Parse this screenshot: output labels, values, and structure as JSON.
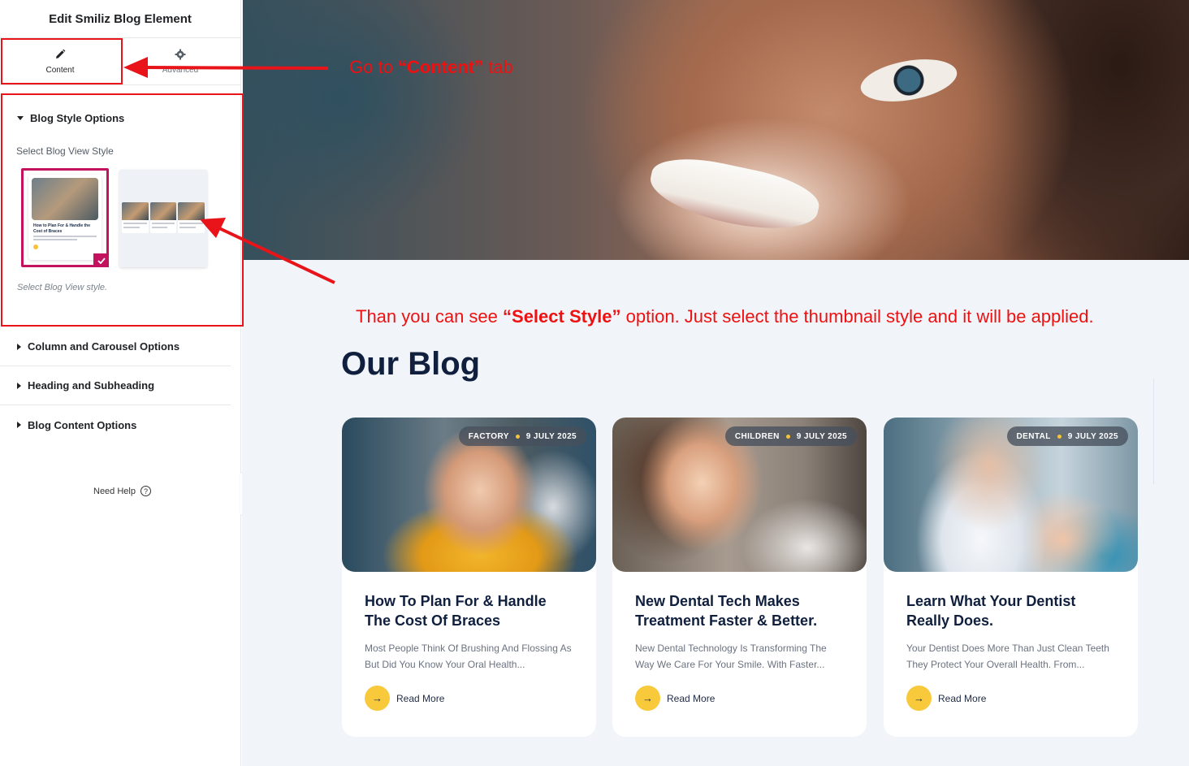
{
  "sidebar": {
    "title": "Edit Smiliz Blog Element",
    "tabs": [
      {
        "label": "Content",
        "icon": "pencil-icon",
        "active": true
      },
      {
        "label": "Advanced",
        "icon": "gear-icon",
        "active": false
      }
    ],
    "blog_style": {
      "header": "Blog Style Options",
      "field_label": "Select Blog View Style",
      "hint": "Select Blog View style.",
      "thumb1": {
        "title": "How to Plan For & Handle the Cost of Braces"
      },
      "selected": 1
    },
    "sections": [
      "Column and Carousel Options",
      "Heading and Subheading",
      "Blog Content Options"
    ],
    "need_help": "Need Help",
    "help_glyph": "?",
    "collapse_glyph": "‹"
  },
  "annotations": {
    "a1_pre": "Go  to ",
    "a1_bold": "“Content”",
    "a1_post": " tab",
    "a2_pre": "Than you can see ",
    "a2_bold": "“Select Style”",
    "a2_post": " option. Just select the thumbnail style and it will be applied."
  },
  "main": {
    "heading": "Our Blog",
    "accent": "#f7c93b",
    "posts": [
      {
        "category": "FACTORY",
        "date": "9 JULY 2025",
        "title": "How To Plan For & Handle The Cost Of Braces",
        "excerpt": "Most People Think Of Brushing And Flossing As But Did You Know Your Oral Health...",
        "read_more": "Read More"
      },
      {
        "category": "CHILDREN",
        "date": "9 JULY 2025",
        "title": "New Dental Tech Makes Treatment Faster & Better.",
        "excerpt": "New Dental Technology Is Transforming The Way We Care For Your Smile. With Faster...",
        "read_more": "Read More"
      },
      {
        "category": "DENTAL",
        "date": "9 JULY 2025",
        "title": "Learn What Your Dentist Really Does.",
        "excerpt": "Your Dentist Does More Than Just Clean Teeth They Protect Your Overall Health. From...",
        "read_more": "Read More"
      }
    ]
  }
}
